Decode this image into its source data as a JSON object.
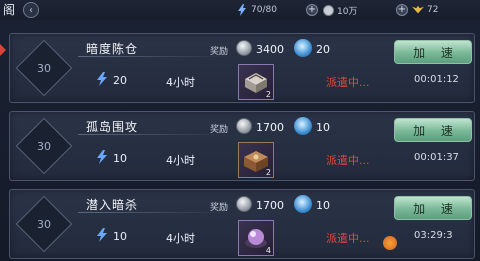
{
  "header": {
    "title": "阁",
    "back_icon": "back-icon",
    "stamina": "70/80",
    "silver": "10万",
    "gold": "72"
  },
  "labels": {
    "reward": "奖励",
    "accelerate": "加 速",
    "dispatching": "派遣中..."
  },
  "missions": [
    {
      "level": "30",
      "name": "暗度陈仓",
      "cost": "20",
      "duration": "4小时",
      "silver": "3400",
      "gems": "20",
      "item_count": "2",
      "timer": "00:01:12",
      "item_icon": "chest-icon"
    },
    {
      "level": "30",
      "name": "孤岛围攻",
      "cost": "10",
      "duration": "4小时",
      "silver": "1700",
      "gems": "10",
      "item_count": "2",
      "timer": "00:01:37",
      "item_icon": "treasure-box-icon"
    },
    {
      "level": "30",
      "name": "潜入暗杀",
      "cost": "10",
      "duration": "4小时",
      "silver": "1700",
      "gems": "10",
      "item_count": "4",
      "timer": "03:29:3",
      "item_icon": "pearl-icon"
    }
  ],
  "colors": {
    "status_red": "#e5493f",
    "button_green": "#79b897",
    "accent_blue": "#3e8fd2"
  }
}
